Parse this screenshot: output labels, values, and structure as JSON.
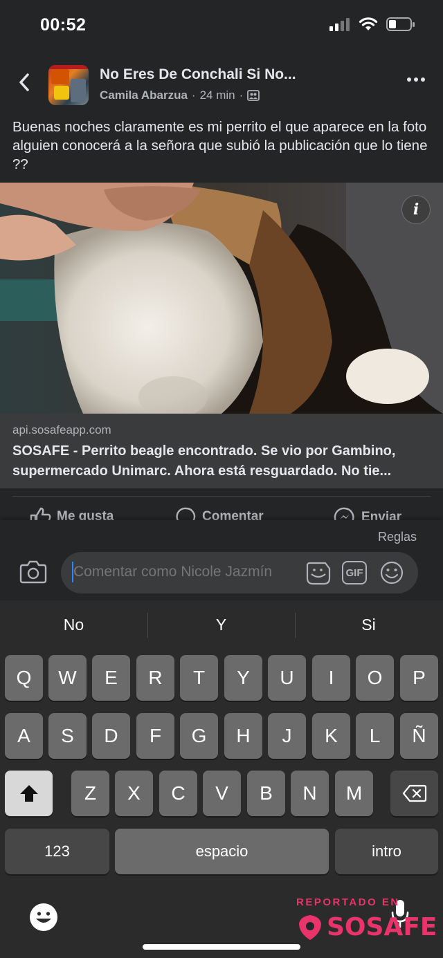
{
  "status": {
    "time": "00:52"
  },
  "post": {
    "group_name": "No Eres De Conchali Si No...",
    "author": "Camila Abarzua",
    "separator": "·",
    "time": "24 min",
    "text": "Buenas noches claramente es mi perrito el que aparece en la foto alguien conocerá a la señora que subió la publicación que lo tiene ??"
  },
  "link": {
    "domain": "api.sosafeapp.com",
    "title": "SOSAFE - Perrito beagle encontrado. Se vio por Gambino, supermercado Unimarc. Ahora está resguardado. No tie..."
  },
  "actions": {
    "like": "Me gusta",
    "comment": "Comentar",
    "send": "Enviar"
  },
  "comment": {
    "rules": "Reglas",
    "placeholder": "Comentar como Nicole Jazmín",
    "gif": "GIF"
  },
  "keyboard": {
    "suggestions": [
      "No",
      "Y",
      "Si"
    ],
    "row1": [
      "Q",
      "W",
      "E",
      "R",
      "T",
      "Y",
      "U",
      "I",
      "O",
      "P"
    ],
    "row2": [
      "A",
      "S",
      "D",
      "F",
      "G",
      "H",
      "J",
      "K",
      "L",
      "Ñ"
    ],
    "row3": [
      "Z",
      "X",
      "C",
      "V",
      "B",
      "N",
      "M"
    ],
    "numbers": "123",
    "space": "espacio",
    "return": "intro"
  },
  "watermark": {
    "top": "REPORTADO EN",
    "brand": "SOSAFE"
  },
  "colors": {
    "background": "#242526",
    "card": "#3a3b3c",
    "accent": "#2d88ff",
    "watermark": "#e8336b"
  }
}
